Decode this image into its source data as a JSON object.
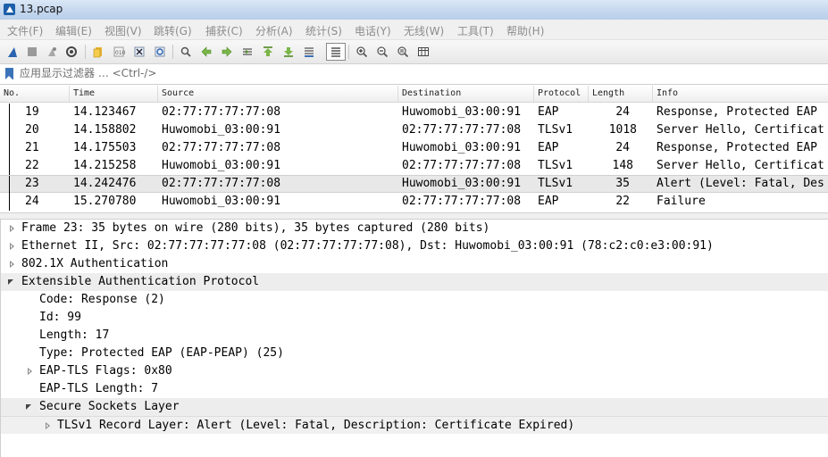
{
  "window": {
    "title": "13.pcap"
  },
  "menu": [
    "文件(F)",
    "编辑(E)",
    "视图(V)",
    "跳转(G)",
    "捕获(C)",
    "分析(A)",
    "统计(S)",
    "电话(Y)",
    "无线(W)",
    "工具(T)",
    "帮助(H)"
  ],
  "toolbar": {
    "icons": [
      "shark-fin-start-icon",
      "stop-icon",
      "restart-icon",
      "capture-options-icon",
      "open-file-icon",
      "save-file-icon",
      "close-file-icon",
      "reload-icon",
      "find-packet-icon",
      "go-back-icon",
      "go-forward-icon",
      "go-to-packet-icon",
      "go-first-icon",
      "go-last-icon",
      "autoscroll-icon",
      "colorize-icon",
      "zoom-in-icon",
      "zoom-out-icon",
      "zoom-normal-icon",
      "resize-columns-icon"
    ]
  },
  "filter": {
    "placeholder": "应用显示过滤器 … <Ctrl-/>"
  },
  "packet_list": {
    "columns": [
      "No.",
      "Time",
      "Source",
      "Destination",
      "Protocol",
      "Length",
      "Info"
    ],
    "rows": [
      {
        "no": "19",
        "time": "14.123467",
        "source": "02:77:77:77:77:08",
        "destination": "Huwomobi_03:00:91",
        "protocol": "EAP",
        "length": "24",
        "info": "Response, Protected EAP"
      },
      {
        "no": "20",
        "time": "14.158802",
        "source": "Huwomobi_03:00:91",
        "destination": "02:77:77:77:77:08",
        "protocol": "TLSv1",
        "length": "1018",
        "info": "Server Hello, Certificat"
      },
      {
        "no": "21",
        "time": "14.175503",
        "source": "02:77:77:77:77:08",
        "destination": "Huwomobi_03:00:91",
        "protocol": "EAP",
        "length": "24",
        "info": "Response, Protected EAP"
      },
      {
        "no": "22",
        "time": "14.215258",
        "source": "Huwomobi_03:00:91",
        "destination": "02:77:77:77:77:08",
        "protocol": "TLSv1",
        "length": "148",
        "info": "Server Hello, Certificat"
      },
      {
        "no": "23",
        "time": "14.242476",
        "source": "02:77:77:77:77:08",
        "destination": "Huwomobi_03:00:91",
        "protocol": "TLSv1",
        "length": "35",
        "info": "Alert (Level: Fatal, Des"
      },
      {
        "no": "24",
        "time": "15.270780",
        "source": "Huwomobi_03:00:91",
        "destination": "02:77:77:77:77:08",
        "protocol": "EAP",
        "length": "22",
        "info": "Failure"
      }
    ]
  },
  "details": [
    {
      "text": "Frame 23: 35 bytes on wire (280 bits), 35 bytes captured (280 bits)",
      "expander": "collapsed"
    },
    {
      "text": "Ethernet II, Src: 02:77:77:77:77:08 (02:77:77:77:77:08), Dst: Huwomobi_03:00:91 (78:c2:c0:e3:00:91)",
      "expander": "collapsed"
    },
    {
      "text": "802.1X Authentication",
      "expander": "collapsed"
    },
    {
      "text": "Extensible Authentication Protocol",
      "expander": "expanded"
    },
    {
      "text": "Code: Response (2)",
      "expander": "none"
    },
    {
      "text": "Id: 99",
      "expander": "none"
    },
    {
      "text": "Length: 17",
      "expander": "none"
    },
    {
      "text": "Type: Protected EAP (EAP-PEAP) (25)",
      "expander": "none"
    },
    {
      "text": "EAP-TLS Flags: 0x80",
      "expander": "collapsed"
    },
    {
      "text": "EAP-TLS Length: 7",
      "expander": "none"
    },
    {
      "text": "Secure Sockets Layer",
      "expander": "expanded"
    },
    {
      "text": "TLSv1 Record Layer: Alert (Level: Fatal, Description: Certificate Expired)",
      "expander": "collapsed"
    }
  ]
}
